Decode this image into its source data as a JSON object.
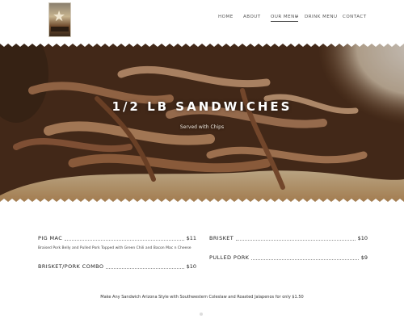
{
  "nav": {
    "items": [
      {
        "label": "HOME"
      },
      {
        "label": "ABOUT"
      },
      {
        "label": "OUR MENU"
      },
      {
        "label": "DRINK MENU"
      },
      {
        "label": "CONTACT"
      }
    ],
    "dropdown_glyph": "+"
  },
  "hero": {
    "title": "1/2 LB SANDWICHES",
    "subtitle": "Served with Chips"
  },
  "menu": {
    "items": [
      {
        "name": "PIG MAC",
        "price": "$11",
        "description": "Braised Pork Belly and Pulled Pork Topped with Green Chili and Bacon Mac n Cheese"
      },
      {
        "name": "BRISKET/PORK COMBO",
        "price": "$10",
        "description": ""
      },
      {
        "name": "BRISKET",
        "price": "$10",
        "description": ""
      },
      {
        "name": "PULLED PORK",
        "price": "$9",
        "description": ""
      }
    ]
  },
  "note": "Make Any Sandwich Arizona Style with Southwestern Coleslaw and Roasted Jalapenos for only $1.50",
  "colors": {
    "background": "#ffffff",
    "text": "#333333",
    "hero_overlay": "#5a3a24"
  }
}
